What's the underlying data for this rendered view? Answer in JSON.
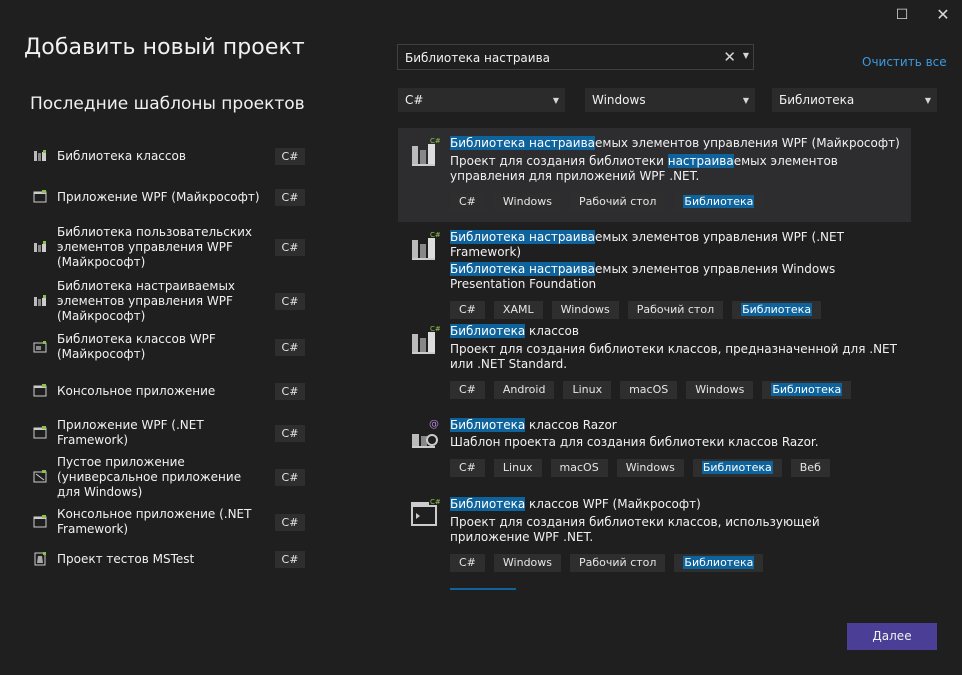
{
  "window": {
    "maximize_icon": "maximize-icon",
    "close_icon": "close-icon"
  },
  "title": "Добавить новый проект",
  "recent": {
    "heading": "Последние шаблоны проектов",
    "items": [
      {
        "label": "Библиотека классов",
        "lang": "C#",
        "icon": "class-library-icon"
      },
      {
        "label": "Приложение WPF (Майкрософт)",
        "lang": "C#",
        "icon": "wpf-app-icon"
      },
      {
        "label": "Библиотека пользовательских элементов управления WPF (Майкрософт)",
        "lang": "C#",
        "icon": "user-control-library-icon"
      },
      {
        "label": "Библиотека настраиваемых элементов управления WPF (Майкрософт)",
        "lang": "C#",
        "icon": "custom-control-library-icon"
      },
      {
        "label": "Библиотека классов WPF (Майкрософт)",
        "lang": "C#",
        "icon": "wpf-class-library-icon"
      },
      {
        "label": "Консольное приложение",
        "lang": "C#",
        "icon": "console-app-icon"
      },
      {
        "label": "Приложение WPF (.NET Framework)",
        "lang": "C#",
        "icon": "wpf-app-icon"
      },
      {
        "label": "Пустое приложение (универсальное приложение для Windows)",
        "lang": "C#",
        "icon": "uwp-app-icon"
      },
      {
        "label": "Консольное приложение (.NET Framework)",
        "lang": "C#",
        "icon": "console-app-icon"
      },
      {
        "label": "Проект тестов MSTest",
        "lang": "C#",
        "icon": "test-project-icon"
      }
    ]
  },
  "search": {
    "value": "Библиотека настраива",
    "clear_icon": "clear-icon",
    "dropdown_icon": "chevron-down-icon"
  },
  "clear_all_label": "Очистить все",
  "filters": {
    "language": "C#",
    "platform": "Windows",
    "project_type": "Библиотека"
  },
  "results": [
    {
      "title_hl": "Библиотека настраива",
      "title_rest": "емых элементов управления WPF (Майкрософт)",
      "desc_pre": "Проект для создания библиотеки ",
      "desc_hl": "настраива",
      "desc_rest": "емых элементов управления для приложений WPF .NET.",
      "tags": [
        "C#",
        "Windows",
        "Рабочий стол"
      ],
      "tag_hl": "Библиотека"
    },
    {
      "title_hl": "Библиотека настраива",
      "title_rest": "емых элементов управления WPF (.NET Framework)",
      "desc_hl": "Библиотека настраива",
      "desc_rest": "емых элементов управления Windows Presentation Foundation",
      "tags": [
        "C#",
        "XAML",
        "Windows",
        "Рабочий стол"
      ],
      "tag_hl": "Библиотека"
    },
    {
      "title_hl": "Библиотека",
      "title_rest": " классов",
      "desc": "Проект для создания библиотеки классов, предназначенной для .NET или .NET Standard.",
      "tags": [
        "C#",
        "Android",
        "Linux",
        "macOS",
        "Windows"
      ],
      "tag_hl": "Библиотека"
    },
    {
      "title_hl": "Библиотека",
      "title_rest": " классов Razor",
      "desc": "Шаблон проекта для создания библиотеки классов Razor.",
      "tags": [
        "C#",
        "Linux",
        "macOS",
        "Windows"
      ],
      "tag_hl": "Библиотека",
      "tag_after": "Веб"
    },
    {
      "title_hl": "Библиотека",
      "title_rest": " классов WPF (Майкрософт)",
      "desc": "Проект для создания библиотеки классов, использующей приложение WPF .NET.",
      "tags": [
        "C#",
        "Windows",
        "Рабочий стол"
      ],
      "tag_hl": "Библиотека"
    }
  ],
  "next_label": "Далее",
  "colors": {
    "background": "#1f1f1f",
    "highlight": "#0e639c",
    "link": "#3b9ae1",
    "primary_button": "#4b3e97"
  }
}
